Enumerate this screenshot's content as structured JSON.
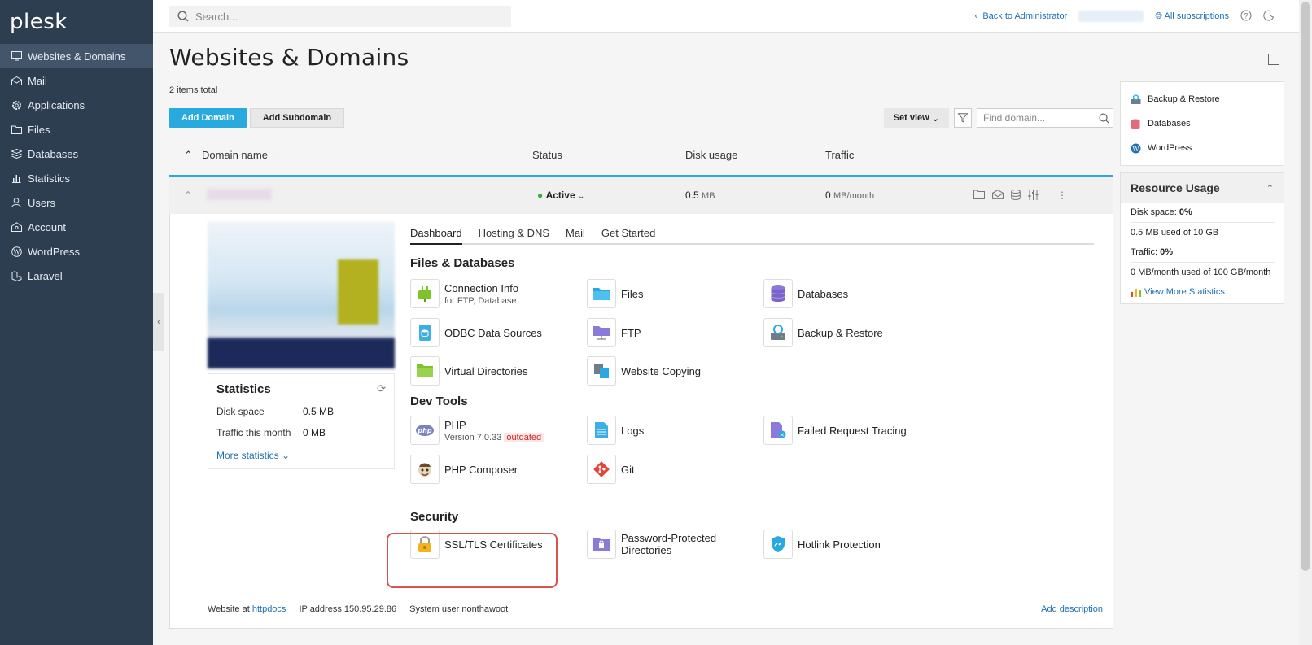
{
  "sidebar": {
    "logo": "plesk",
    "items": [
      {
        "label": "Websites & Domains",
        "icon": "monitor-icon"
      },
      {
        "label": "Mail",
        "icon": "mail-icon"
      },
      {
        "label": "Applications",
        "icon": "gear-icon"
      },
      {
        "label": "Files",
        "icon": "folder-icon"
      },
      {
        "label": "Databases",
        "icon": "layers-icon"
      },
      {
        "label": "Statistics",
        "icon": "chart-icon"
      },
      {
        "label": "Users",
        "icon": "user-icon"
      },
      {
        "label": "Account",
        "icon": "account-icon"
      },
      {
        "label": "WordPress",
        "icon": "wordpress-icon"
      },
      {
        "label": "Laravel",
        "icon": "laravel-icon"
      }
    ]
  },
  "topbar": {
    "search_placeholder": "Search...",
    "back_label": "Back to Administrator",
    "subscriptions_label": "All subscriptions"
  },
  "page": {
    "title": "Websites & Domains",
    "items_total": "2 items total",
    "add_domain": "Add Domain",
    "add_subdomain": "Add Subdomain",
    "set_view": "Set view",
    "find_placeholder": "Find domain..."
  },
  "table": {
    "col_domain": "Domain name",
    "col_status": "Status",
    "col_disk": "Disk usage",
    "col_traffic": "Traffic",
    "row": {
      "status": "Active",
      "disk_value": "0.5",
      "disk_unit": "MB",
      "traffic_value": "0",
      "traffic_unit": "MB/month"
    }
  },
  "stats": {
    "title": "Statistics",
    "disk_label": "Disk space",
    "disk_value": "0.5 MB",
    "traffic_label": "Traffic this month",
    "traffic_value": "0 MB",
    "more": "More statistics"
  },
  "tabs": [
    "Dashboard",
    "Hosting & DNS",
    "Mail",
    "Get Started"
  ],
  "sections": {
    "files_db": "Files & Databases",
    "dev_tools": "Dev Tools",
    "security": "Security"
  },
  "tools": {
    "connection_info": "Connection Info",
    "connection_info_sub": "for FTP, Database",
    "files": "Files",
    "databases": "Databases",
    "odbc": "ODBC Data Sources",
    "ftp": "FTP",
    "backup": "Backup & Restore",
    "virtual_dirs": "Virtual Directories",
    "website_copying": "Website Copying",
    "php": "PHP",
    "php_version": "Version 7.0.33",
    "php_outdated": "outdated",
    "logs": "Logs",
    "failed_tracing": "Failed Request Tracing",
    "composer": "PHP Composer",
    "git": "Git",
    "ssl": "SSL/TLS Certificates",
    "pwd_dirs_1": "Password-Protected",
    "pwd_dirs_2": "Directories",
    "hotlink": "Hotlink Protection"
  },
  "footer": {
    "website_at": "Website at",
    "httpdocs": "httpdocs",
    "ip_label": "IP address",
    "ip_value": "150.95.29.86",
    "sysuser_label": "System user",
    "sysuser_value": "nonthawoot",
    "add_description": "Add description"
  },
  "right": {
    "quick_links": [
      "Backup & Restore",
      "Databases",
      "WordPress"
    ],
    "resource_title": "Resource Usage",
    "disk_space_label": "Disk space:",
    "disk_space_pct": "0%",
    "disk_used": "0.5 MB used of 10 GB",
    "traffic_label": "Traffic:",
    "traffic_pct": "0%",
    "traffic_used": "0 MB/month used of 100 GB/month",
    "view_more": "View More Statistics"
  }
}
